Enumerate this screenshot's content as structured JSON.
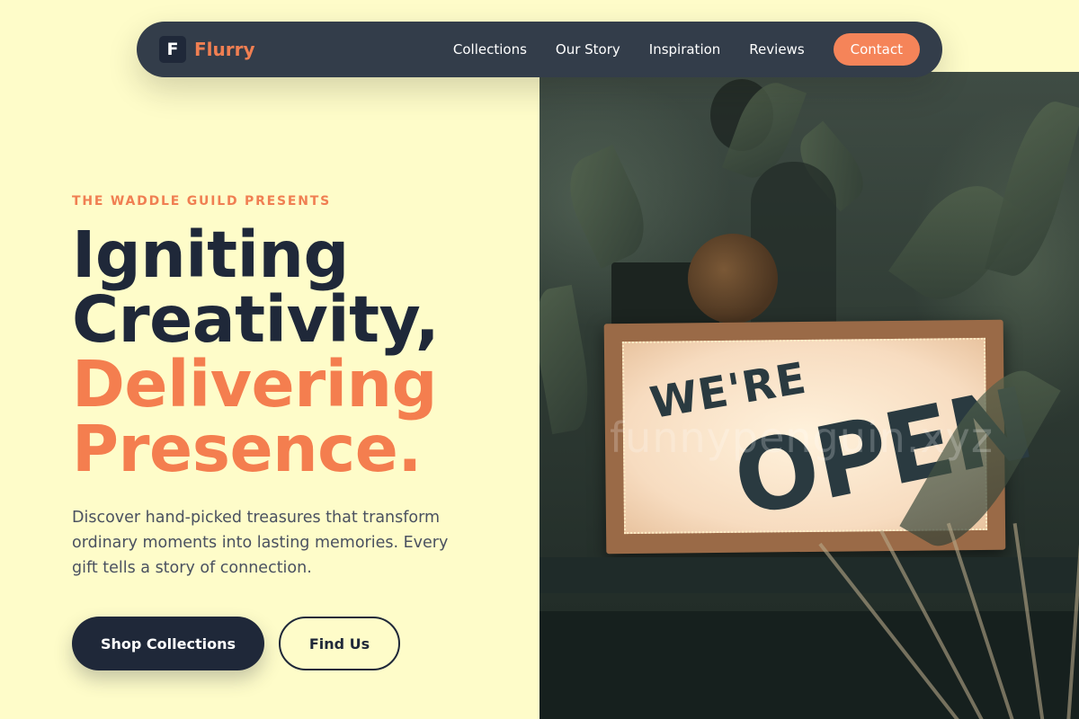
{
  "nav": {
    "logo_letter": "F",
    "brand": "Flurry",
    "links": [
      "Collections",
      "Our Story",
      "Inspiration",
      "Reviews"
    ],
    "contact": "Contact"
  },
  "hero": {
    "eyebrow": "THE WADDLE GUILD PRESENTS",
    "headline": [
      "Igniting",
      "Creativity,",
      "Delivering",
      "Presence."
    ],
    "description": "Discover hand-picked treasures that transform ordinary moments into lasting memories. Every gift tells a story of connection.",
    "primary_button": "Shop Collections",
    "secondary_button": "Find Us"
  },
  "photo": {
    "sign_line1": "WE'RE",
    "sign_line2": "OPEN",
    "watermark": "funnypenguin.xyz"
  },
  "colors": {
    "background": "#fefcc9",
    "navy": "#1f2839",
    "nav_bar": "#333d4a",
    "accent": "#f47e4f",
    "body_text": "#4a5160"
  }
}
